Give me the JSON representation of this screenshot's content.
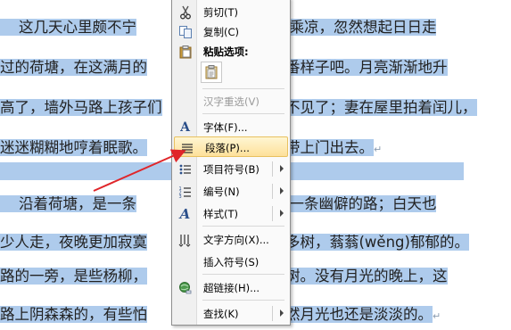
{
  "document": {
    "lines": [
      {
        "left": "    这几天心里颇不宁",
        "right": "里坐着乘凉，忽然想起日日走"
      },
      {
        "left": "过的荷塘，在这满月的",
        "right": "有一番样子吧。月亮渐渐地升"
      },
      {
        "left": "高了，墙外马路上孩子们",
        "right": "听不见了；妻在屋里拍着闰儿，"
      },
      {
        "left": "迷迷糊糊地哼着眠歌。",
        "right": "衫，带上门出去。"
      },
      {
        "left": "",
        "right": ""
      },
      {
        "left": "    沿着荷塘，是一条",
        "right": "。这是一条幽僻的路；白天也"
      },
      {
        "left": "少人走，夜晚更加寂寞",
        "right": "着许多树，蓊蓊(wěng)郁郁的。"
      },
      {
        "left": "路的一旁，是些杨柳，",
        "right": "字的树。没有月光的晚上，这"
      },
      {
        "left": "路上阴森森的，有些怕",
        "right": "，虽然月光也还是淡淡的。"
      }
    ],
    "paragraph_mark": "↵"
  },
  "context_menu": {
    "items": [
      {
        "id": "cut",
        "label": "剪切(T)",
        "icon": "scissors-icon"
      },
      {
        "id": "copy",
        "label": "复制(C)",
        "icon": "copy-icon"
      },
      {
        "id": "paste-options",
        "label": "粘贴选项:",
        "icon": "clipboard-icon"
      },
      {
        "id": "paste-keep",
        "label": "",
        "icon": "paste-keep-text-icon"
      },
      {
        "id": "hanzi-reconvert",
        "label": "汉字重选(V)",
        "icon": "",
        "disabled": true
      },
      {
        "id": "font",
        "label": "字体(F)...",
        "icon": "font-icon"
      },
      {
        "id": "paragraph",
        "label": "段落(P)...",
        "icon": "paragraph-icon",
        "selected": true
      },
      {
        "id": "bullets",
        "label": "项目符号(B)",
        "icon": "bullets-icon",
        "submenu": true
      },
      {
        "id": "numbering",
        "label": "编号(N)",
        "icon": "numbering-icon",
        "submenu": true
      },
      {
        "id": "styles",
        "label": "样式(T)",
        "icon": "styles-icon",
        "submenu": true
      },
      {
        "id": "text-direction",
        "label": "文字方向(X)...",
        "icon": "text-direction-icon"
      },
      {
        "id": "insert-symbol",
        "label": "插入符号(S)",
        "icon": ""
      },
      {
        "id": "hyperlink",
        "label": "超链接(H)...",
        "icon": "hyperlink-icon"
      },
      {
        "id": "find",
        "label": "查找(K)",
        "icon": "",
        "submenu": true
      }
    ]
  },
  "colors": {
    "highlight": "#aecbec",
    "menu_hover": "#fde09a",
    "arrow": "#e0262a"
  }
}
